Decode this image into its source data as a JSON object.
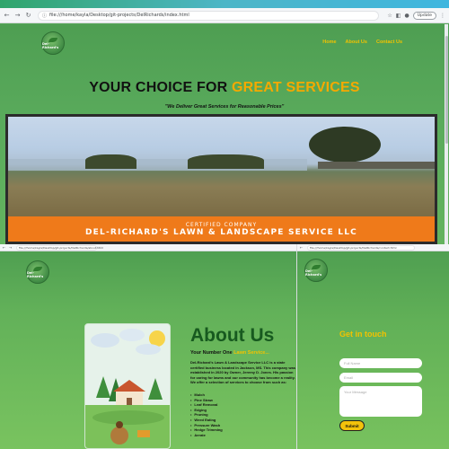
{
  "browser_top": {
    "url": "file:///home/kayla/Desktop/git-projects/DelRichards/index.html",
    "update_label": "Update"
  },
  "site": {
    "logo_text": "Del-Richard's",
    "nav": [
      "Home",
      "About Us",
      "Contact Us"
    ],
    "hero_title_prefix": "YOUR CHOICE FOR ",
    "hero_title_accent": "GREAT SERVICES",
    "hero_subtitle": "\"We Deliver Great Services for Reasonable Prices\"",
    "banner_line1": "CERTIFIED COMPANY",
    "banner_line2": "DEL-RICHARD'S LAWN & LANDSCAPE SERVICE LLC"
  },
  "browser_bottom_left": {
    "url": "file:///home/kayla/Desktop/git-projects/DelRichards/about.html"
  },
  "about": {
    "title": "About Us",
    "subtitle_prefix": "Your Number One ",
    "subtitle_accent": "Lawn Service...",
    "body": "Del-Richard's Lawn & Landscape Service LLC is a state certified business located in Jackson, MS. This company was established in 2020 by Owner, Jeremy D. Jones. His passion for caring for lawns and our community has become a reality. We offer a selection of services to choose from such as:",
    "services": [
      "Mulch",
      "Pine Straw",
      "Leaf Removal",
      "Edging",
      "Pruning",
      "Weed Eating",
      "Pressure Wash",
      "Hedge Trimming",
      "Aerate"
    ]
  },
  "browser_bottom_right": {
    "url": "file:///home/kayla/Desktop/git-projects/DelRichards/contact.html"
  },
  "contact": {
    "title": "Get in touch",
    "name_placeholder": "Full Name",
    "email_placeholder": "Email",
    "message_placeholder": "Your Message",
    "submit_label": "Submit"
  },
  "colors": {
    "brand_green": "#5aab5c",
    "accent_yellow": "#f2c200",
    "banner_orange": "#ef7a1a",
    "heading_green": "#175a1f"
  }
}
